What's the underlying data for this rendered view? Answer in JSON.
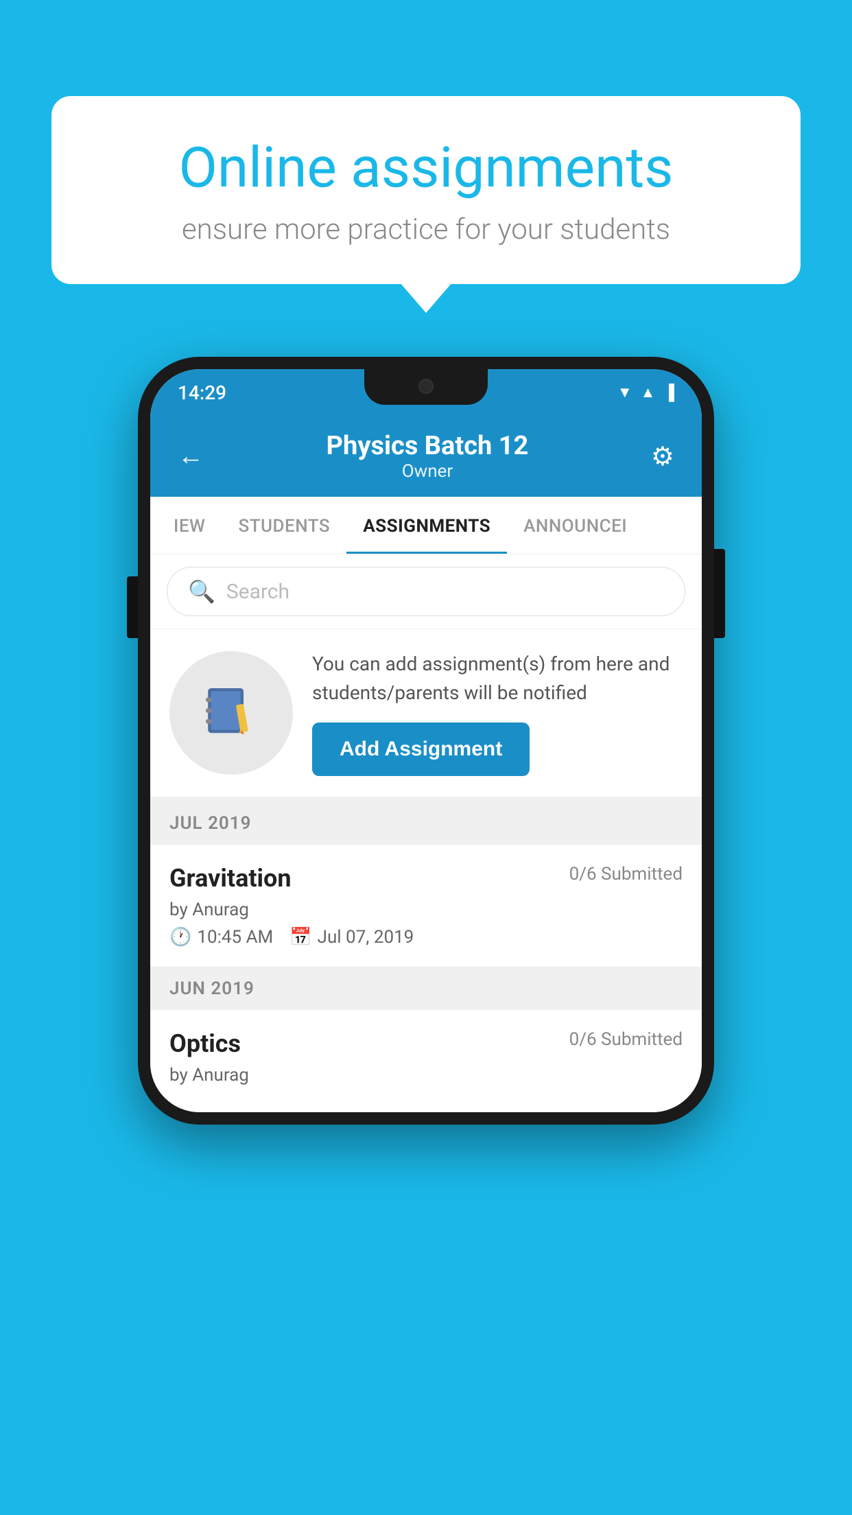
{
  "background_color": "#1ab8e8",
  "speech_bubble": {
    "title": "Online assignments",
    "subtitle": "ensure more practice for your students"
  },
  "phone": {
    "status_bar": {
      "time": "14:29",
      "wifi": "▲",
      "signal": "▲",
      "battery": "▊"
    },
    "header": {
      "title": "Physics Batch 12",
      "subtitle": "Owner",
      "back_icon": "←",
      "gear_icon": "⚙"
    },
    "tabs": [
      {
        "label": "IEW",
        "active": false
      },
      {
        "label": "STUDENTS",
        "active": false
      },
      {
        "label": "ASSIGNMENTS",
        "active": true
      },
      {
        "label": "ANNOUNCEI",
        "active": false
      }
    ],
    "search": {
      "placeholder": "Search"
    },
    "promo": {
      "text": "You can add assignment(s) from here and students/parents will be notified",
      "button_label": "Add Assignment"
    },
    "sections": [
      {
        "month": "JUL 2019",
        "assignments": [
          {
            "name": "Gravitation",
            "submitted": "0/6 Submitted",
            "by": "by Anurag",
            "time": "10:45 AM",
            "date": "Jul 07, 2019"
          }
        ]
      },
      {
        "month": "JUN 2019",
        "assignments": [
          {
            "name": "Optics",
            "submitted": "0/6 Submitted",
            "by": "by Anurag",
            "time": "",
            "date": ""
          }
        ]
      }
    ]
  }
}
